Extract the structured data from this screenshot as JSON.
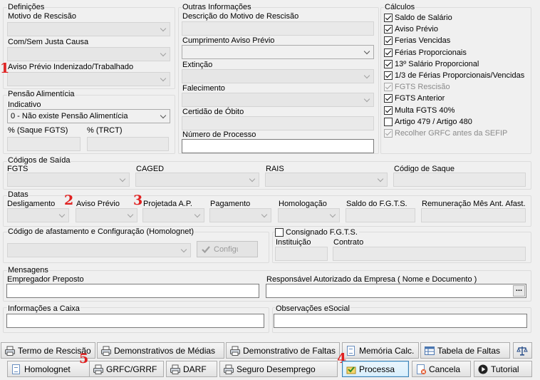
{
  "definicoes": {
    "title": "Definições",
    "motivo_label": "Motivo de Rescisão",
    "justa_causa_label": "Com/Sem Justa Causa",
    "aviso_label": "Aviso Prévio Indenizado/Trabalhado"
  },
  "pensao": {
    "title": "Pensão Alimentícia",
    "indicativo_label": "Indicativo",
    "indicativo_value": "0 - Não existe Pensão Alimentícia",
    "saque_label": "% (Saque FGTS)",
    "trct_label": "% (TRCT)"
  },
  "outras": {
    "title": "Outras Informações",
    "descricao_label": "Descrição do Motivo de Rescisão",
    "cumprimento_label": "Cumprimento Aviso Prévio",
    "extincao_label": "Extinção",
    "falecimento_label": "Falecimento",
    "certidao_label": "Certidão de Óbito",
    "processo_label": "Número de Processo"
  },
  "calculos": {
    "title": "Cálculos",
    "items": [
      {
        "label": "Saldo de Salário",
        "checked": true,
        "enabled": true
      },
      {
        "label": "Aviso Prévio",
        "checked": true,
        "enabled": true
      },
      {
        "label": "Ferias Vencidas",
        "checked": true,
        "enabled": true
      },
      {
        "label": "Férias Proporcionais",
        "checked": true,
        "enabled": true
      },
      {
        "label": "13º Salário Proporcional",
        "checked": true,
        "enabled": true
      },
      {
        "label": "1/3 de Férias Proporcionais/Vencidas",
        "checked": true,
        "enabled": true
      },
      {
        "label": "FGTS Rescisão",
        "checked": true,
        "enabled": false
      },
      {
        "label": "FGTS Anterior",
        "checked": true,
        "enabled": true
      },
      {
        "label": "Multa FGTS 40%",
        "checked": true,
        "enabled": true
      },
      {
        "label": "Artigo 479 / Artigo 480",
        "checked": false,
        "enabled": true
      },
      {
        "label": "Recolher GRFC antes da SEFIP",
        "checked": true,
        "enabled": false
      }
    ]
  },
  "codigos": {
    "title": "Códigos de Saída",
    "fgts_label": "FGTS",
    "caged_label": "CAGED",
    "rais_label": "RAIS",
    "saque_label": "Código de Saque"
  },
  "datas": {
    "title": "Datas",
    "desligamento_label": "Desligamento",
    "aviso_label": "Aviso Prévio",
    "projetada_label": "Projetada A.P.",
    "pagamento_label": "Pagamento",
    "homologacao_label": "Homologação",
    "saldo_fgts_label": "Saldo do F.G.T.S.",
    "remuneracao_label": "Remuneração Mês Ant. Afast."
  },
  "afastamento": {
    "title": "Código de afastamento e Configuração (Homolognet)",
    "config_label": "Configuração"
  },
  "consignado": {
    "label": "Consignado F.G.T.S.",
    "instituicao_label": "Instituição",
    "contrato_label": "Contrato"
  },
  "mensagens": {
    "title": "Mensagens",
    "empregador_label": "Empregador Preposto",
    "responsavel_label": "Responsável Autorizado da Empresa ( Nome e Documento )",
    "ellipsis_label": "...",
    "caixa_label": "Informações a Caixa",
    "esocial_label": "Observações eSocial"
  },
  "buttons": {
    "termo": "Termo de Rescisão",
    "medias": "Demonstrativos de Médias",
    "faltas": "Demonstrativo de Faltas",
    "memoria": "Memória Calc.",
    "tabela_faltas": "Tabela de Faltas",
    "homolognet": "Homolognet",
    "grfc": "GRFC/GRRF",
    "darf": "DARF",
    "seguro": "Seguro Desemprego",
    "processa": "Processa",
    "cancela": "Cancela",
    "tutorial": "Tutorial"
  },
  "annotations": [
    "1",
    "2",
    "3",
    "4",
    "5"
  ],
  "colors": {
    "annotation": "#e02020",
    "selected_border": "#3c7fb1"
  }
}
